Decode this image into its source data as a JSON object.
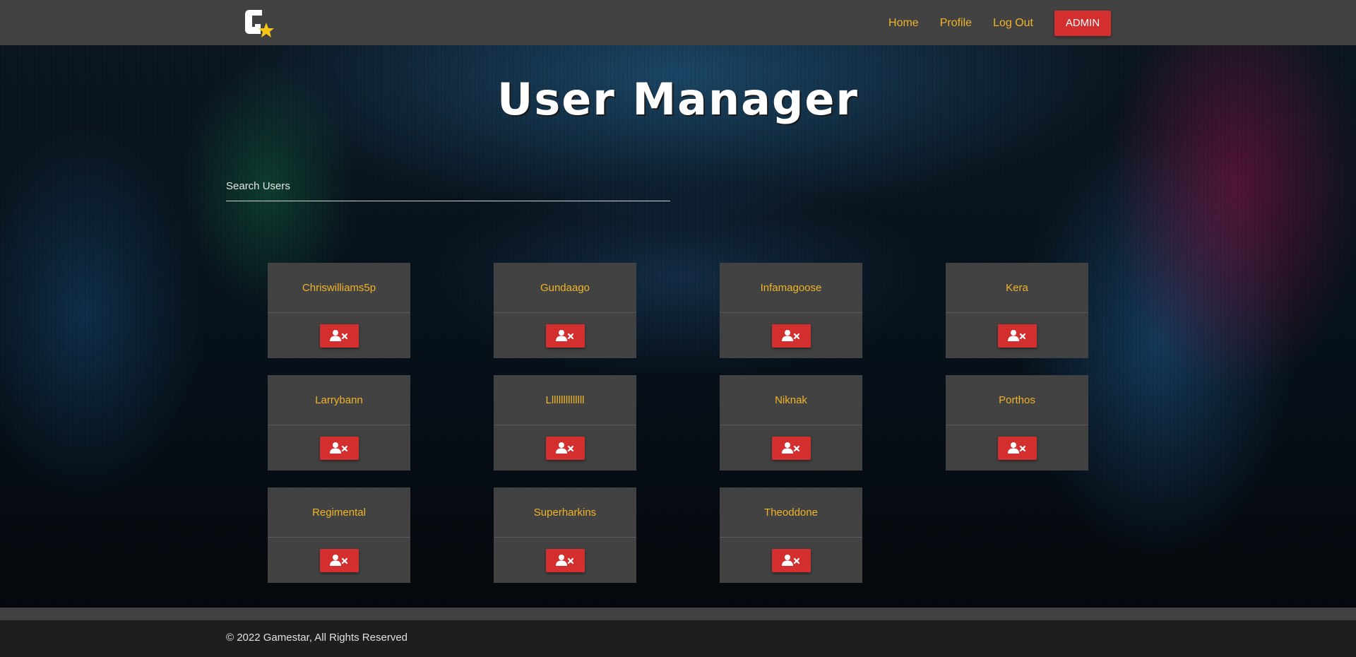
{
  "nav": {
    "logo_icon": "gamestar-logo-icon",
    "links": [
      "Home",
      "Profile",
      "Log Out"
    ],
    "admin_label": "ADMIN"
  },
  "page": {
    "title": "User Manager"
  },
  "search": {
    "placeholder": "Search Users",
    "value": ""
  },
  "users": [
    {
      "name": "Chriswilliams5p",
      "action_icon": "remove-user-icon"
    },
    {
      "name": "Gundaago",
      "action_icon": "remove-user-icon"
    },
    {
      "name": "Infamagoose",
      "action_icon": "remove-user-icon"
    },
    {
      "name": "Kera",
      "action_icon": "remove-user-icon"
    },
    {
      "name": "Larrybann",
      "action_icon": "remove-user-icon"
    },
    {
      "name": "Lllllllllllllll",
      "action_icon": "remove-user-icon"
    },
    {
      "name": "Niknak",
      "action_icon": "remove-user-icon"
    },
    {
      "name": "Porthos",
      "action_icon": "remove-user-icon"
    },
    {
      "name": "Regimental",
      "action_icon": "remove-user-icon"
    },
    {
      "name": "Superharkins",
      "action_icon": "remove-user-icon"
    },
    {
      "name": "Theoddone",
      "action_icon": "remove-user-icon"
    }
  ],
  "footer": {
    "text": "© 2022 Gamestar, All Rights Reserved"
  },
  "colors": {
    "accent": "#f0b429",
    "danger": "#d32f2f",
    "panel": "#424242"
  }
}
